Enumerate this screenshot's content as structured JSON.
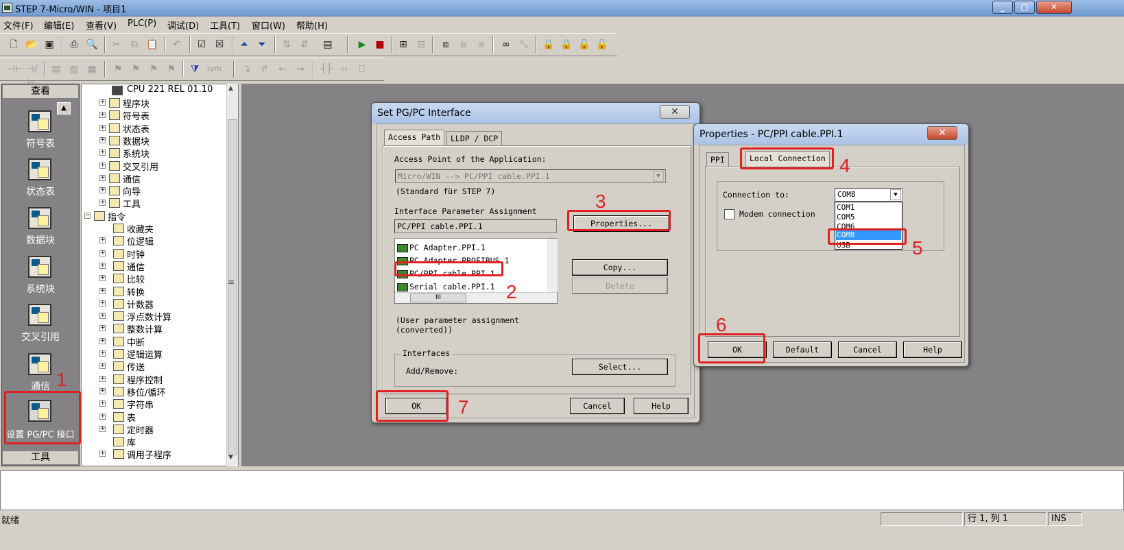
{
  "window": {
    "title": "STEP 7-Micro/WIN - 项目1"
  },
  "menu": [
    "文件(F)",
    "编辑(E)",
    "查看(V)",
    "PLC(P)",
    "调试(D)",
    "工具(T)",
    "窗口(W)",
    "帮助(H)"
  ],
  "nav": {
    "header": "查看",
    "footer": "工具",
    "items": [
      "符号表",
      "状态表",
      "数据块",
      "系统块",
      "交叉引用",
      "通信",
      "设置 PG/PC 接口"
    ]
  },
  "tree": {
    "cpu": "CPU 221 REL 01.10",
    "items": [
      "程序块",
      "符号表",
      "状态表",
      "数据块",
      "系统块",
      "交叉引用",
      "通信",
      "向导",
      "工具",
      "指令",
      "收藏夹",
      "位逻辑",
      "时钟",
      "通信",
      "比较",
      "转换",
      "计数器",
      "浮点数计算",
      "整数计算",
      "中断",
      "逻辑运算",
      "传送",
      "程序控制",
      "移位/循环",
      "字符串",
      "表",
      "定时器",
      "库",
      "调用子程序"
    ]
  },
  "dlg1": {
    "title": "Set PG/PC Interface",
    "tabs": [
      "Access Path",
      "LLDP / DCP"
    ],
    "access_label": "Access Point of the Application:",
    "access_value": "Micro/WIN      --> PC/PPI cable.PPI.1",
    "standard": "(Standard für STEP 7)",
    "param_label": "Interface Parameter Assignment",
    "param_value": "PC/PPI cable.PPI.1",
    "list": [
      "PC Adapter.PPI.1",
      "PC Adapter.PROFIBUS.1",
      "PC/PPI cable.PPI.1",
      "Serial cable.PPI.1"
    ],
    "scroll_thumb": "III",
    "note1": "(User parameter assignment",
    "note2": "(converted))",
    "interfaces_label": "Interfaces",
    "addremove": "Add/Remove:",
    "btn_properties": "Properties...",
    "btn_copy": "Copy...",
    "btn_delete": "Delete",
    "btn_select": "Select...",
    "btn_ok": "OK",
    "btn_cancel": "Cancel",
    "btn_help": "Help"
  },
  "dlg2": {
    "title": "Properties - PC/PPI cable.PPI.1",
    "tabs": [
      "PPI",
      "Local Connection"
    ],
    "conn_label": "Connection to:",
    "conn_value": "COM8",
    "options": [
      "COM1",
      "COM5",
      "COM6",
      "COM8",
      "USB"
    ],
    "modem": "Modem connection",
    "btn_ok": "OK",
    "btn_default": "Default",
    "btn_cancel": "Cancel",
    "btn_help": "Help"
  },
  "annotations": [
    "1",
    "2",
    "3",
    "4",
    "5",
    "6",
    "7"
  ],
  "status": {
    "left": "就绪",
    "pos": "行 1, 列 1",
    "mode": "INS"
  },
  "colors": {
    "annotation": "#e02020",
    "selection": "#3399ff",
    "workspace": "#848284"
  }
}
